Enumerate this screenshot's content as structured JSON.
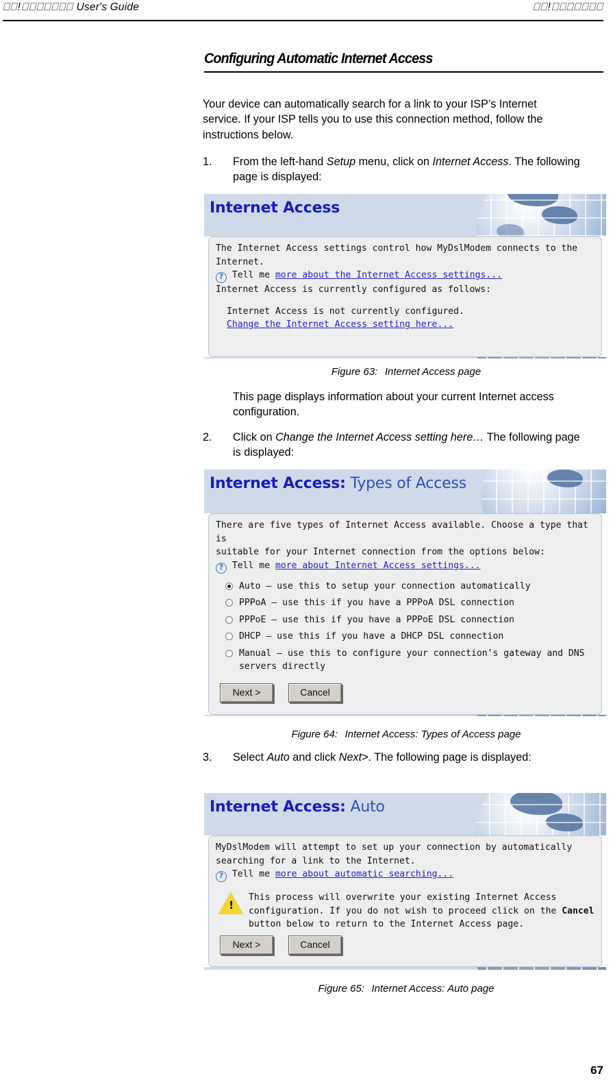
{
  "header": {
    "left_tofu_prefix": "⎕⎕",
    "left_text": "User's Guide",
    "left_full": "⎕⎕!⎕⎕⎕⎕⎕⎕⎕",
    "right_full": "⎕⎕!⎕⎕⎕⎕⎕⎕⎕"
  },
  "section": {
    "title": "Configuring Automatic Internet Access",
    "intro": "Your device can automatically search for a link to your ISP’s Internet service. If your ISP tells you to use this connection method, follow the instructions below."
  },
  "steps": {
    "one": {
      "num": "1.",
      "text_a": "From the left-hand ",
      "em_a": "Setup",
      "text_b": " menu, click on ",
      "em_b": "Internet Access",
      "text_c": ". The following page is displayed:"
    },
    "one_note": "This page displays information about your current Internet access configuration.",
    "two": {
      "num": "2.",
      "text_a": "Click on ",
      "em_a": "Change the Internet Access setting here…",
      "text_b": " The following page is displayed:"
    },
    "three": {
      "num": "3.",
      "text_a": "Select ",
      "em_a": "Auto",
      "text_b": " and click ",
      "em_b": "Next>",
      "text_c": ". The following page is displayed:"
    }
  },
  "figures": {
    "f63": {
      "num": "Figure 63:",
      "caption": "Internet Access page"
    },
    "f64": {
      "num": "Figure 64:",
      "caption": "Internet Access: Types of Access page"
    },
    "f65": {
      "num": "Figure 65:",
      "caption": "Internet Access: Auto page"
    }
  },
  "shot1": {
    "title": "Internet Access",
    "line1": "The Internet Access settings control how MyDslModem connects to the",
    "line2": "Internet.",
    "tell_me": "Tell me",
    "link1": "more about the Internet Access settings...",
    "line3": "Internet Access is currently configured as follows:",
    "line4": "Internet Access is not currently configured.",
    "link2": "Change the Internet Access setting here..."
  },
  "shot2": {
    "title_bold": "Internet Access:",
    "title_sub": " Types of Access",
    "line1": "There are five types of Internet Access available. Choose a type that is",
    "line2": "suitable for your Internet connection from the options below:",
    "tell_me": "Tell me",
    "link1": "more about Internet Access settings...",
    "options": [
      {
        "label": "Auto – use this to setup your connection automatically",
        "selected": true
      },
      {
        "label": "PPPoA – use this if you have a PPPoA DSL connection",
        "selected": false
      },
      {
        "label": "PPPoE – use this if you have a PPPoE DSL connection",
        "selected": false
      },
      {
        "label": "DHCP – use this if you have a DHCP DSL connection",
        "selected": false
      },
      {
        "label": "Manual – use this to configure your connection's gateway and DNS servers directly",
        "selected": false
      }
    ],
    "btn_next": "Next >",
    "btn_cancel": "Cancel"
  },
  "shot3": {
    "title_bold": "Internet Access:",
    "title_sub": " Auto",
    "line1": "MyDslModem will attempt to set up your connection by automatically",
    "line2": "searching for a link to the Internet.",
    "tell_me": "Tell me",
    "link1": "more about automatic searching...",
    "warn_a": "This process will overwrite your existing Internet Access configuration. If you do not wish to proceed click on the ",
    "warn_bold": "Cancel",
    "warn_b": " button below to return to the Internet Access page.",
    "btn_next": "Next >",
    "btn_cancel": "Cancel"
  },
  "footer": {
    "page_number": "67"
  },
  "colors": {
    "banner_blue": "#cfdae9",
    "title_blue": "#1b1bbd",
    "link_blue": "#2222cc",
    "panel_gray": "#eeeeee",
    "button_face": "#d4d0c8",
    "warn_yellow": "#f5d52e"
  }
}
